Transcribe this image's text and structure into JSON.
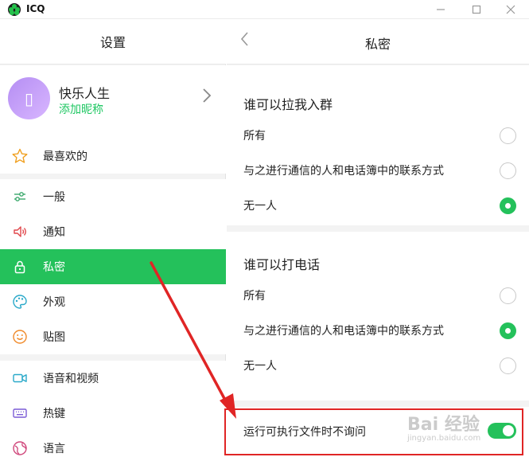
{
  "titlebar": {
    "app_title": "ICQ",
    "minimize_icon": "minimize-icon",
    "maximize_icon": "maximize-icon",
    "close_icon": "close-icon"
  },
  "left": {
    "header": "设置",
    "profile": {
      "name": "快乐人生",
      "subtitle": "添加昵称",
      "avatar_glyph": "▯"
    },
    "items": [
      {
        "label": "最喜欢的",
        "icon": "star-icon",
        "active": false
      },
      {
        "label": "一般",
        "icon": "sliders-icon",
        "active": false
      },
      {
        "label": "通知",
        "icon": "speaker-icon",
        "active": false
      },
      {
        "label": "私密",
        "icon": "lock-icon",
        "active": true
      },
      {
        "label": "外观",
        "icon": "palette-icon",
        "active": false
      },
      {
        "label": "贴图",
        "icon": "smiley-icon",
        "active": false
      },
      {
        "label": "语音和视频",
        "icon": "video-icon",
        "active": false
      },
      {
        "label": "热键",
        "icon": "keyboard-icon",
        "active": false
      },
      {
        "label": "语言",
        "icon": "globe-icon",
        "active": false
      }
    ]
  },
  "right": {
    "title": "私密",
    "sections": [
      {
        "title": "谁可以拉我入群",
        "options": [
          {
            "label": "所有",
            "selected": false
          },
          {
            "label": "与之进行通信的人和电话簿中的联系方式",
            "selected": false
          },
          {
            "label": "无一人",
            "selected": true
          }
        ]
      },
      {
        "title": "谁可以打电话",
        "options": [
          {
            "label": "所有",
            "selected": false
          },
          {
            "label": "与之进行通信的人和电话簿中的联系方式",
            "selected": true
          },
          {
            "label": "无一人",
            "selected": false
          }
        ]
      }
    ],
    "toggle_row": {
      "label": "运行可执行文件时不询问",
      "on": true
    }
  },
  "colors": {
    "accent": "#24c15b",
    "annotation": "#e02525"
  },
  "watermark": {
    "text": "Bai 经验",
    "sub": "jingyan.baidu.com"
  }
}
